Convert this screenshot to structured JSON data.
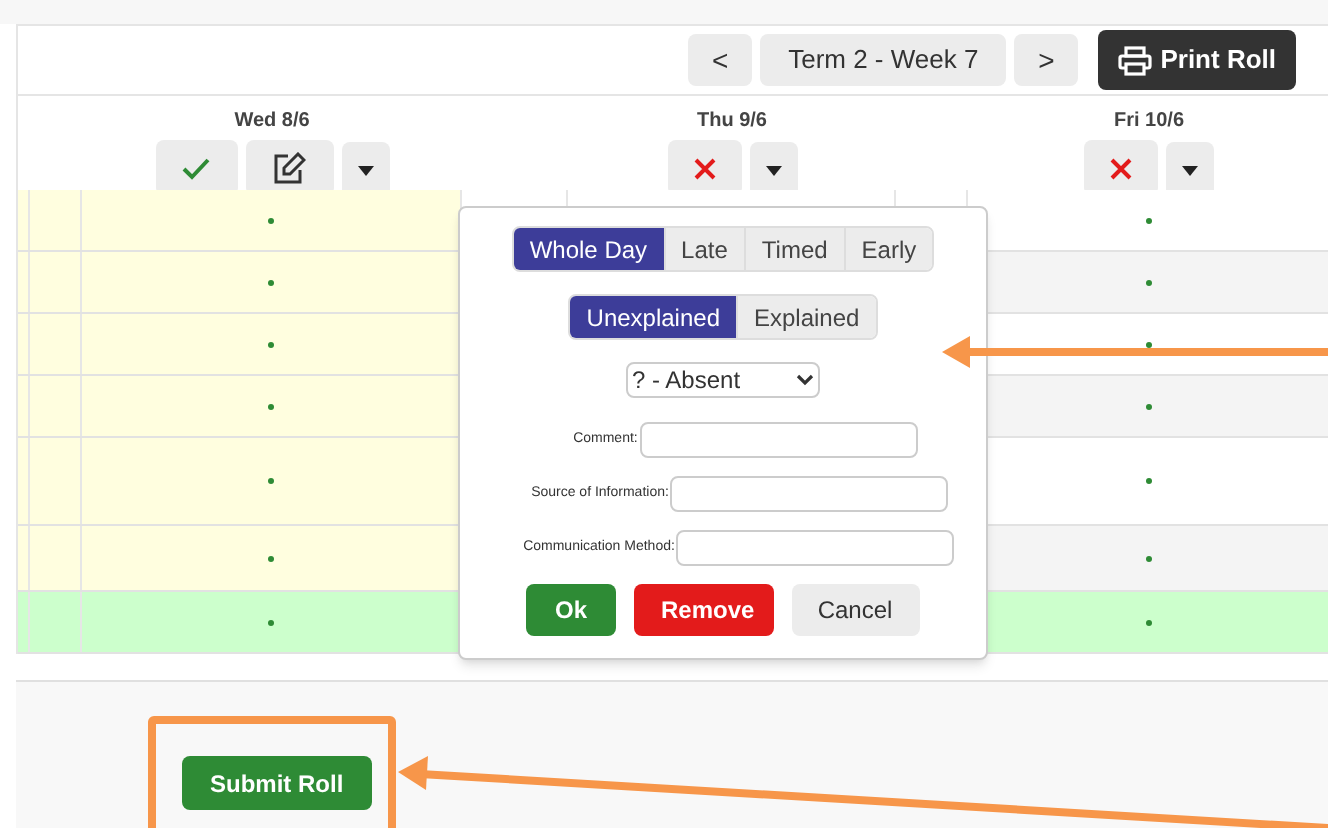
{
  "toolbar": {
    "prev": "<",
    "week": "Term 2 - Week 7",
    "next": ">",
    "print": "Print Roll"
  },
  "days": [
    {
      "label": "Wed 8/6",
      "buttons": [
        {
          "kind": "present"
        },
        {
          "kind": "edit"
        },
        {
          "kind": "menu"
        }
      ]
    },
    {
      "label": "Thu 9/6",
      "buttons": [
        {
          "kind": "absent"
        },
        {
          "kind": "menu"
        }
      ]
    },
    {
      "label": "Fri 10/6",
      "buttons": [
        {
          "kind": "absent"
        },
        {
          "kind": "menu"
        }
      ]
    }
  ],
  "rows": [
    {
      "selected": false
    },
    {
      "selected": false
    },
    {
      "selected": false
    },
    {
      "selected": false
    },
    {
      "selected": false
    },
    {
      "selected": false
    },
    {
      "selected": true
    }
  ],
  "popup": {
    "types": [
      {
        "label": "Whole Day",
        "selected": true
      },
      {
        "label": "Late",
        "selected": false
      },
      {
        "label": "Timed",
        "selected": false
      },
      {
        "label": "Early",
        "selected": false
      }
    ],
    "explanations": [
      {
        "label": "Unexplained",
        "selected": true
      },
      {
        "label": "Explained",
        "selected": false
      }
    ],
    "reason": "? - Absent",
    "fields": [
      {
        "label": "Comment:"
      },
      {
        "label": "Source of Information:"
      },
      {
        "label": "Communication Method:"
      }
    ],
    "buttons": [
      {
        "label": "Ok",
        "kind": "ok"
      },
      {
        "label": "Remove",
        "kind": "remove"
      },
      {
        "label": "Cancel",
        "kind": "cancel"
      }
    ]
  },
  "submit": "Submit Roll"
}
